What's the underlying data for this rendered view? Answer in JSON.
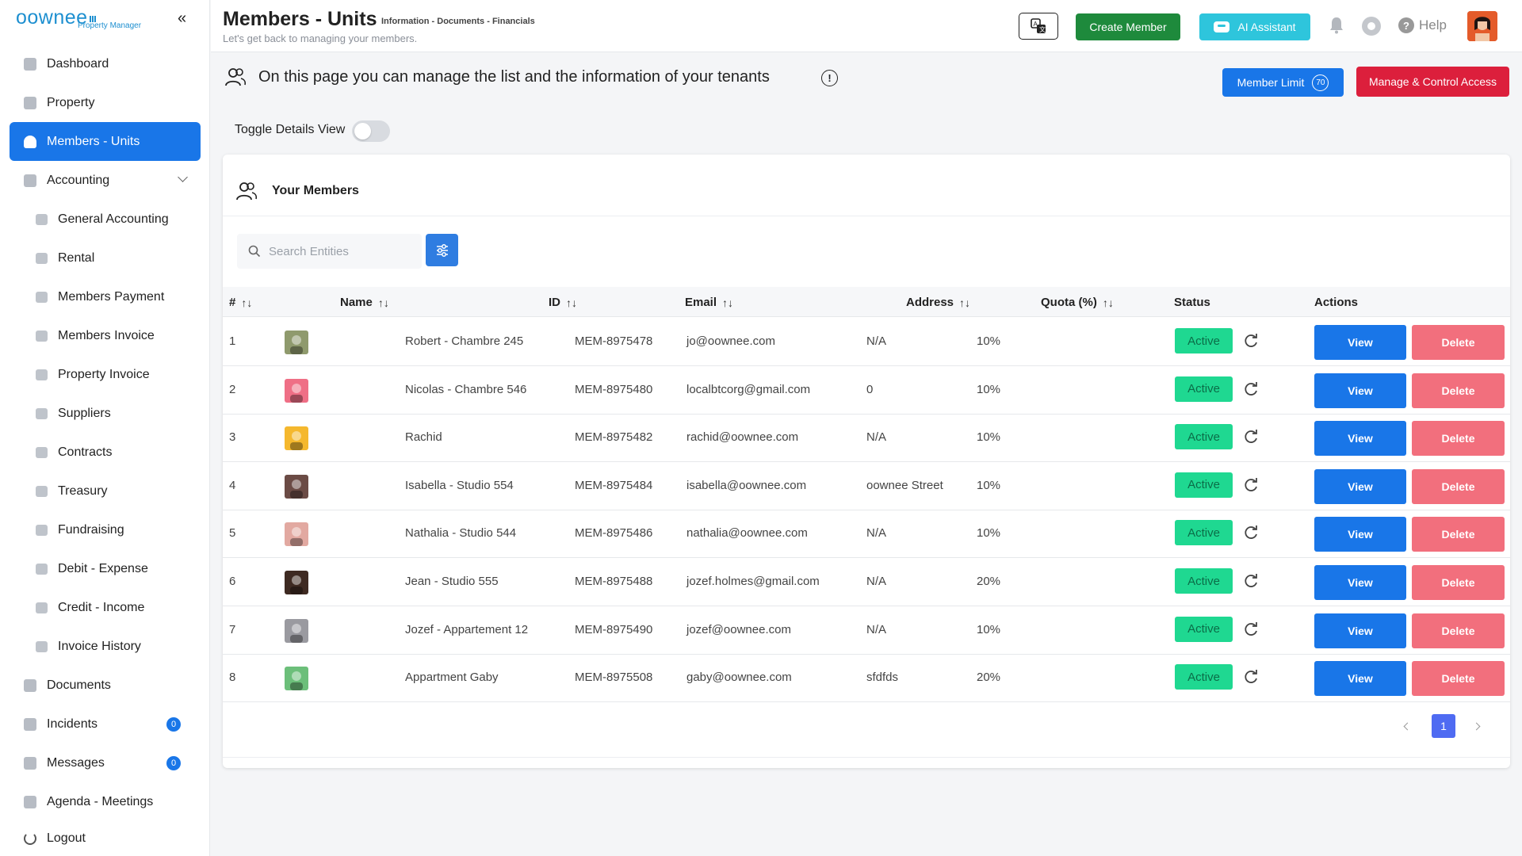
{
  "brand": {
    "name": "oownee",
    "subtitle": "Property Manager"
  },
  "sidebar": {
    "items": [
      {
        "label": "Dashboard",
        "icon": "dashboard-icon"
      },
      {
        "label": "Property",
        "icon": "property-icon"
      },
      {
        "label": "Members - Units",
        "icon": "members-icon",
        "active": true
      },
      {
        "label": "Accounting",
        "icon": "accounting-icon",
        "expandable": true
      },
      {
        "label": "General Accounting",
        "icon": "ledger-icon",
        "sub": true
      },
      {
        "label": "Rental",
        "icon": "rental-icon",
        "sub": true
      },
      {
        "label": "Members Payment",
        "icon": "payment-icon",
        "sub": true
      },
      {
        "label": "Members Invoice",
        "icon": "invoice-icon",
        "sub": true
      },
      {
        "label": "Property Invoice",
        "icon": "invoice-icon",
        "sub": true
      },
      {
        "label": "Suppliers",
        "icon": "suppliers-icon",
        "sub": true
      },
      {
        "label": "Contracts",
        "icon": "contracts-icon",
        "sub": true
      },
      {
        "label": "Treasury",
        "icon": "treasury-icon",
        "sub": true
      },
      {
        "label": "Fundraising",
        "icon": "fundraising-icon",
        "sub": true
      },
      {
        "label": "Debit - Expense",
        "icon": "debit-icon",
        "sub": true
      },
      {
        "label": "Credit - Income",
        "icon": "credit-icon",
        "sub": true
      },
      {
        "label": "Invoice History",
        "icon": "history-icon",
        "sub": true
      },
      {
        "label": "Documents",
        "icon": "documents-icon"
      },
      {
        "label": "Incidents",
        "icon": "incidents-icon",
        "badge": "0"
      },
      {
        "label": "Messages",
        "icon": "messages-icon",
        "badge": "0"
      },
      {
        "label": "Agenda - Meetings",
        "icon": "calendar-icon"
      },
      {
        "label": "Logout",
        "icon": "logout-icon",
        "logout": true
      }
    ]
  },
  "header": {
    "title": "Members - Units",
    "crumbs": "Information - Documents - Financials",
    "subtitle": "Let's get back to managing your members.",
    "create_label": "Create Member",
    "ai_label": "AI Assistant",
    "help_label": "Help"
  },
  "intro": {
    "text": "On this page you can manage the list and the information of your tenants",
    "member_limit_label": "Member Limit",
    "member_limit_count": "70",
    "access_label": "Manage & Control Access",
    "toggle_label": "Toggle Details View"
  },
  "card": {
    "title": "Your Members",
    "search_placeholder": "Search Entities"
  },
  "table": {
    "columns": [
      "#",
      "Name",
      "ID",
      "Email",
      "Address",
      "Quota (%)",
      "Status",
      "Actions"
    ],
    "rows": [
      {
        "num": "1",
        "name": "Robert - Chambre 245",
        "id": "MEM-8975478",
        "email": "jo@oownee.com",
        "address": "N/A",
        "quota": "10%",
        "status": "Active",
        "avatar_color": "#8f9a6d"
      },
      {
        "num": "2",
        "name": "Nicolas - Chambre 546",
        "id": "MEM-8975480",
        "email": "localbtcorg@gmail.com",
        "address": "0",
        "quota": "10%",
        "status": "Active",
        "avatar_color": "#ef6f86"
      },
      {
        "num": "3",
        "name": "Rachid",
        "id": "MEM-8975482",
        "email": "rachid@oownee.com",
        "address": "N/A",
        "quota": "10%",
        "status": "Active",
        "avatar_color": "#f5b82e"
      },
      {
        "num": "4",
        "name": "Isabella - Studio 554",
        "id": "MEM-8975484",
        "email": "isabella@oownee.com",
        "address": "oownee Street",
        "quota": "10%",
        "status": "Active",
        "avatar_color": "#6b4b45"
      },
      {
        "num": "5",
        "name": "Nathalia - Studio 544",
        "id": "MEM-8975486",
        "email": "nathalia@oownee.com",
        "address": "N/A",
        "quota": "10%",
        "status": "Active",
        "avatar_color": "#e2a9a1"
      },
      {
        "num": "6",
        "name": "Jean - Studio 555",
        "id": "MEM-8975488",
        "email": "jozef.holmes@gmail.com",
        "address": "N/A",
        "quota": "20%",
        "status": "Active",
        "avatar_color": "#3e2a22"
      },
      {
        "num": "7",
        "name": "Jozef - Appartement 12",
        "id": "MEM-8975490",
        "email": "jozef@oownee.com",
        "address": "N/A",
        "quota": "10%",
        "status": "Active",
        "avatar_color": "#9a9aa0"
      },
      {
        "num": "8",
        "name": "Appartment Gaby",
        "id": "MEM-8975508",
        "email": "gaby@oownee.com",
        "address": "sfdfds",
        "quota": "20%",
        "status": "Active",
        "avatar_color": "#6cbf7a"
      }
    ],
    "view_label": "View",
    "delete_label": "Delete"
  },
  "pagination": {
    "current": "1"
  },
  "colors": {
    "primary": "#1976e8",
    "success": "#1e8a3c",
    "danger": "#dc1f3c",
    "ai": "#2ec5dc",
    "status_active": "#1fd891",
    "delete": "#f26f7d"
  }
}
